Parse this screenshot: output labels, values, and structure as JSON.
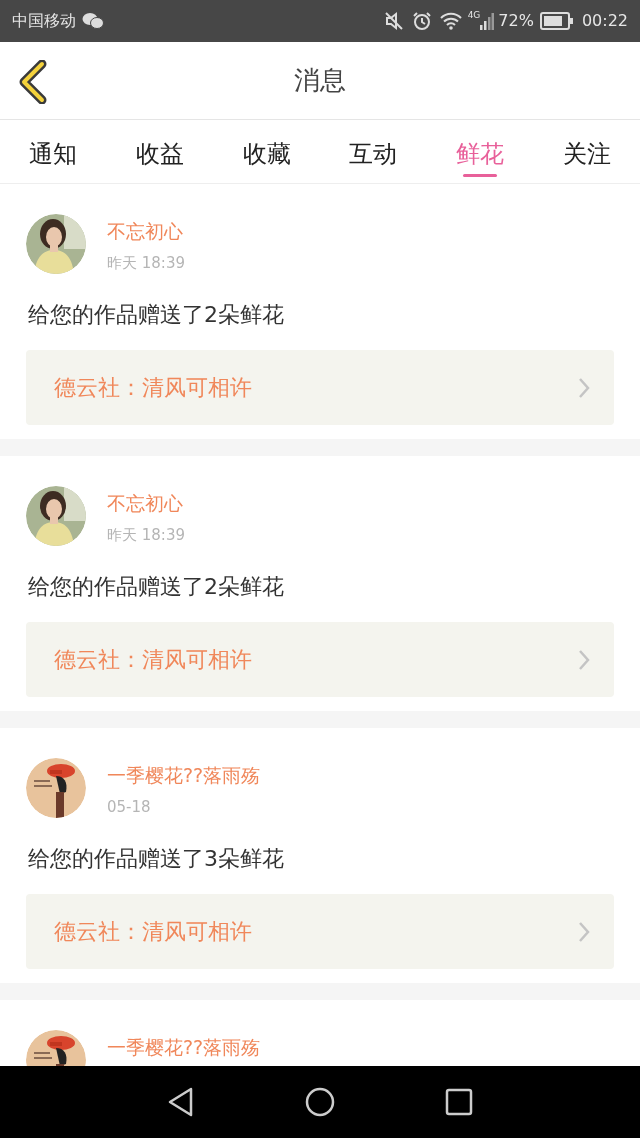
{
  "status_bar": {
    "carrier": "中国移动",
    "network": "4G",
    "battery": "72%",
    "time": "00:22"
  },
  "header": {
    "title": "消息"
  },
  "tabs": [
    {
      "label": "通知",
      "selected": false
    },
    {
      "label": "收益",
      "selected": false
    },
    {
      "label": "收藏",
      "selected": false
    },
    {
      "label": "互动",
      "selected": false
    },
    {
      "label": "鲜花",
      "selected": true
    },
    {
      "label": "关注",
      "selected": false
    }
  ],
  "messages": [
    {
      "name": "不忘初心",
      "time": "昨天 18:39",
      "text": "给您的作品赠送了2朵鲜花",
      "work": "德云社：清风可相许"
    },
    {
      "name": "不忘初心",
      "time": "昨天 18:39",
      "text": "给您的作品赠送了2朵鲜花",
      "work": "德云社：清风可相许"
    },
    {
      "name": "一季樱花??落雨殇",
      "time": "05-18",
      "text": "给您的作品赠送了3朵鲜花",
      "work": "德云社：清风可相许"
    },
    {
      "name": "一季樱花??落雨殇"
    }
  ]
}
